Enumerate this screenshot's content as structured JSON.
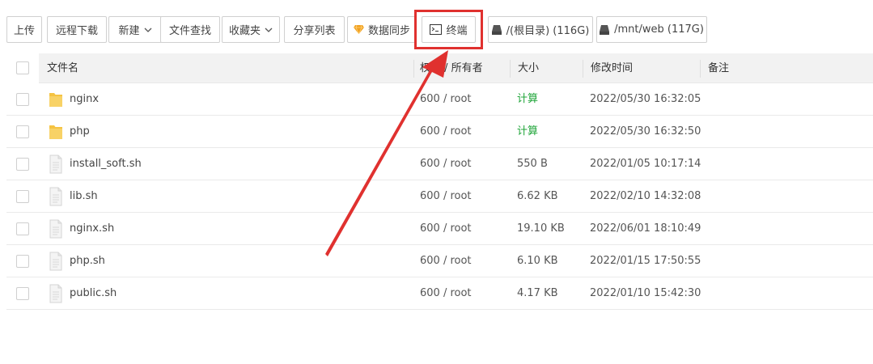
{
  "toolbar": {
    "upload": "上传",
    "remote_download": "远程下载",
    "new": "新建",
    "file_search": "文件查找",
    "favorites": "收藏夹",
    "share_list": "分享列表",
    "data_sync": "数据同步",
    "terminal": "终端",
    "disk_root": "/(根目录) (116G)",
    "disk_web": "/mnt/web (117G)"
  },
  "table": {
    "headers": {
      "name": "文件名",
      "perm": "权限 / 所有者",
      "size": "大小",
      "mtime": "修改时间",
      "note": "备注"
    },
    "rows": [
      {
        "name": "nginx",
        "type": "folder",
        "perm": "600 / root",
        "size": "计算",
        "mtime": "2022/05/30 16:32:05"
      },
      {
        "name": "php",
        "type": "folder",
        "perm": "600 / root",
        "size": "计算",
        "mtime": "2022/05/30 16:32:50"
      },
      {
        "name": "install_soft.sh",
        "type": "file",
        "perm": "600 / root",
        "size": "550 B",
        "mtime": "2022/01/05 10:17:14"
      },
      {
        "name": "lib.sh",
        "type": "file",
        "perm": "600 / root",
        "size": "6.62 KB",
        "mtime": "2022/02/10 14:32:08"
      },
      {
        "name": "nginx.sh",
        "type": "file",
        "perm": "600 / root",
        "size": "19.10 KB",
        "mtime": "2022/06/01 18:10:49"
      },
      {
        "name": "php.sh",
        "type": "file",
        "perm": "600 / root",
        "size": "6.10 KB",
        "mtime": "2022/01/15 17:50:55"
      },
      {
        "name": "public.sh",
        "type": "file",
        "perm": "600 / root",
        "size": "4.17 KB",
        "mtime": "2022/01/10 15:42:30"
      }
    ]
  },
  "colors": {
    "highlight": "#e0312f",
    "calc_green": "#20a53a",
    "folder": "#f5c342",
    "sync_icon": "#f0a020"
  }
}
